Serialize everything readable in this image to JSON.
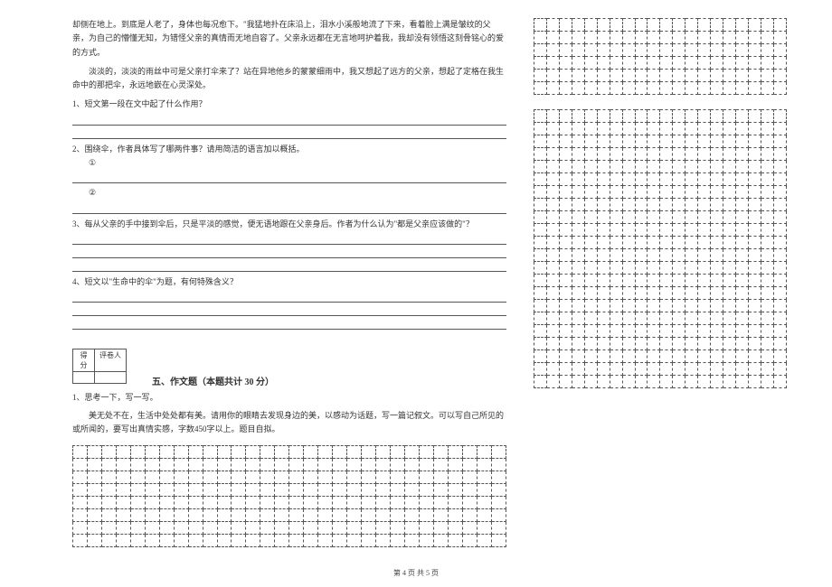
{
  "passage": {
    "p1": "却侧在地上。到底是人老了，身体也每况愈下。\"我猛地扑在床沿上，泪水小溪般地流了下来，看着脸上满是皱纹的父亲，为自己的懵懂无知，为错怪父亲的真情而无地自容了。父亲永远都在无言地呵护着我，我却没有领悟这刻骨铭心的爱的方式。",
    "p2": "淡淡的，淡淡的雨丝中可是父亲打伞来了？站在异地他乡的蒙蒙细雨中，我又想起了远方的父亲，想起了定格在我生命中的那把伞，永远地嵌在心灵深处。"
  },
  "questions": {
    "q1": "1、短文第一段在文中起了什么作用？",
    "q2": "2、围绕伞，作者具体写了哪两件事？请用简洁的语言加以概括。",
    "q2_sub1": "①",
    "q2_sub2": "②",
    "q3": "3、每从父亲的手中接到伞后，只是平淡的感觉，便无语地跟在父亲身后。作者为什么认为\"都是父亲应该做的\"？",
    "q4": "4、短文以\"生命中的伞\"为题，有何特殊含义？"
  },
  "score_box": {
    "col1": "得分",
    "col2": "评卷人"
  },
  "section5": {
    "title": "五、作文题（本题共计 30 分）",
    "prompt_line": "1、思考一下，写一写。",
    "prompt_body": "美无处不在，生活中处处都有美。请用你的眼睛去发现身边的美，以感动为话题，写一篇记叙文。可以写自己所见的或所闻的，要写出真情实感，字数450字以上。题目自拟。"
  },
  "footer": "第 4 页 共 5 页",
  "grid": {
    "bottom_rows": 8,
    "bottom_cols": 30,
    "right_block1_rows": 6,
    "right_block2_rows": 22,
    "right_cols": 20
  }
}
